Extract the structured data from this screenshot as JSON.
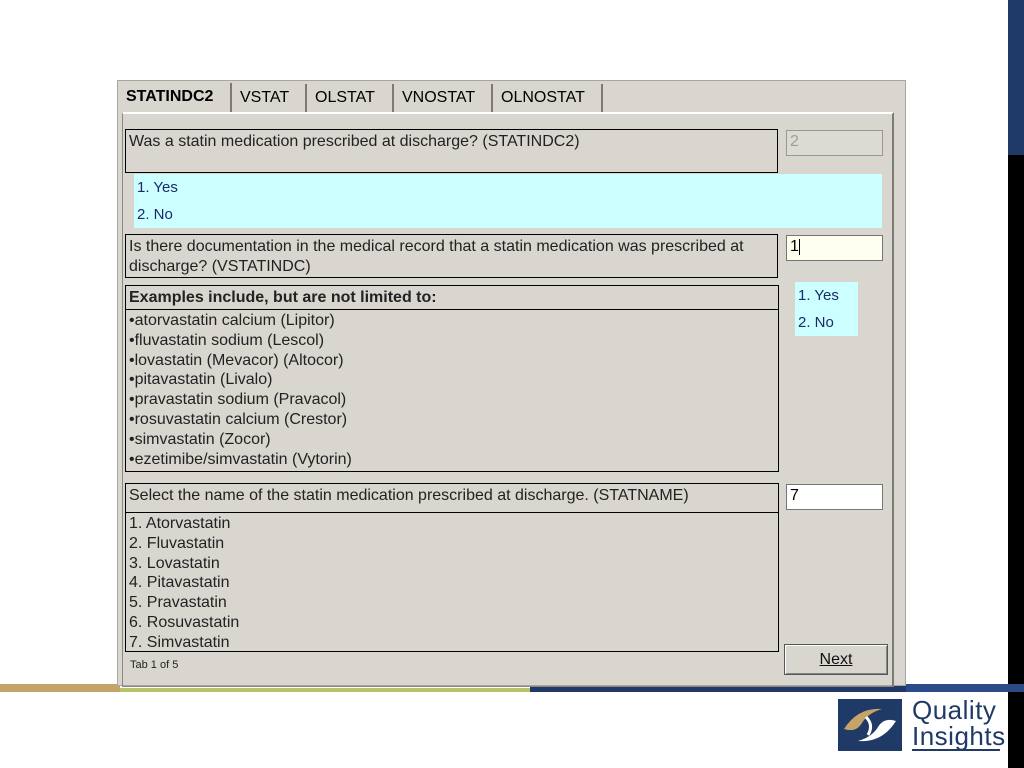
{
  "tabs": [
    {
      "label": "STATINDC2",
      "active": true
    },
    {
      "label": "VSTAT",
      "active": false
    },
    {
      "label": "OLSTAT",
      "active": false
    },
    {
      "label": "VNOSTAT",
      "active": false
    },
    {
      "label": "OLNOSTAT",
      "active": false
    }
  ],
  "q1": {
    "text": "Was a statin medication prescribed at discharge? (STATINDC2)",
    "value": "2",
    "options": [
      "1. Yes",
      "2. No"
    ]
  },
  "q2": {
    "text": "Is there documentation in the medical record that a statin medication was prescribed at discharge?  (VSTATINDC)",
    "value": "1",
    "options": [
      "1. Yes",
      "2. No"
    ],
    "examples_header": "Examples include, but are not limited to:",
    "examples": [
      "•atorvastatin calcium (Lipitor)",
      "•fluvastatin sodium (Lescol)",
      "•lovastatin (Mevacor) (Altocor)",
      "•pitavastatin (Livalo)",
      "•pravastatin sodium (Pravacol)",
      "•rosuvastatin calcium (Crestor)",
      "•simvastatin (Zocor)",
      "•ezetimibe/simvastatin (Vytorin)"
    ]
  },
  "q3": {
    "text": "Select the name of the statin medication prescribed at discharge.   (STATNAME)",
    "value": "7",
    "options": [
      "1. Atorvastatin",
      "2. Fluvastatin",
      "3. Lovastatin",
      "4. Pitavastatin",
      "5. Pravastatin",
      "6. Rosuvastatin",
      "7. Simvastatin"
    ]
  },
  "next_label": "Next",
  "tab_info": "Tab 1 of 5",
  "logo": {
    "line1": "Quality",
    "line2": "Insights"
  },
  "colors": {
    "window_bg": "#d9d6d0",
    "option_bg": "#ccffff",
    "option_text": "#1a2a6a",
    "brand_navy": "#1f3a66",
    "brand_gold": "#c5a46a"
  }
}
